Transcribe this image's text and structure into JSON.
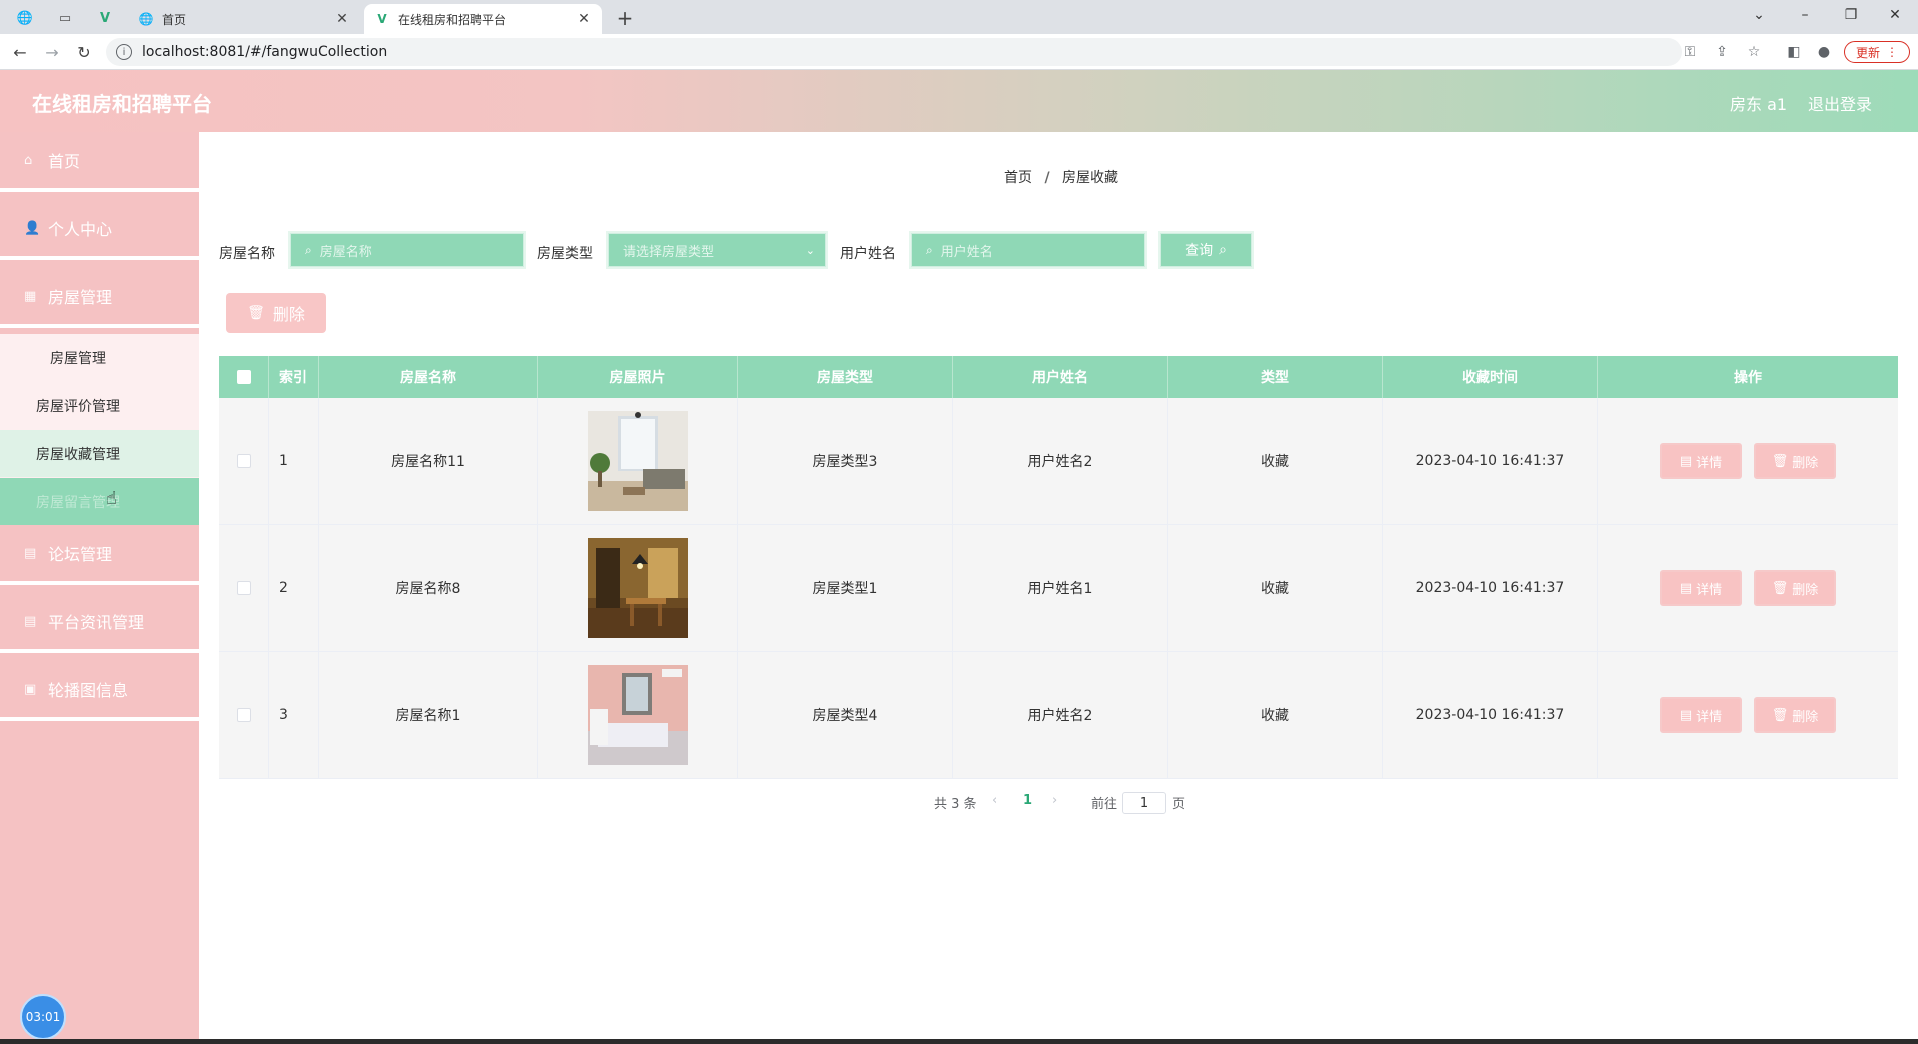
{
  "browser": {
    "tabs": [
      {
        "title": "首页",
        "close": "✕"
      },
      {
        "title": "在线租房和招聘平台",
        "close": "✕"
      }
    ],
    "new_tab": "+",
    "url": "localhost:8081/#/fangwuCollection",
    "update_label": "更新",
    "window_controls": {
      "chevron": "⌄",
      "minimize": "–",
      "restore": "❐",
      "close": "✕"
    }
  },
  "header": {
    "title": "在线租房和招聘平台",
    "user": "房东 a1",
    "logout": "退出登录"
  },
  "sidebar": {
    "items": [
      {
        "label": "首页",
        "icon": "home-icon"
      },
      {
        "label": "个人中心",
        "icon": "user-icon"
      },
      {
        "label": "房屋管理",
        "icon": "house-icon"
      },
      {
        "label": "论坛管理",
        "icon": "forum-icon"
      },
      {
        "label": "平台资讯管理",
        "icon": "news-icon"
      },
      {
        "label": "轮播图信息",
        "icon": "image-icon"
      }
    ],
    "submenu": [
      {
        "label": "房屋管理"
      },
      {
        "label": "房屋评价管理"
      },
      {
        "label": "房屋收藏管理"
      },
      {
        "label": "房屋留言管理"
      }
    ],
    "clock": "03:01"
  },
  "breadcrumb": {
    "home": "首页",
    "sep": "/",
    "current": "房屋收藏"
  },
  "filters": {
    "name_label": "房屋名称",
    "name_placeholder": "房屋名称",
    "type_label": "房屋类型",
    "type_placeholder": "请选择房屋类型",
    "user_label": "用户姓名",
    "user_placeholder": "用户姓名",
    "query_label": "查询"
  },
  "bulk_delete_label": "删除",
  "table": {
    "headers": [
      "索引",
      "房屋名称",
      "房屋照片",
      "房屋类型",
      "用户姓名",
      "类型",
      "收藏时间",
      "操作"
    ],
    "detail_label": "详情",
    "delete_label": "删除",
    "rows": [
      {
        "index": "1",
        "name": "房屋名称11",
        "type": "房屋类型3",
        "user": "用户姓名2",
        "kind": "收藏",
        "time": "2023-04-10 16:41:37"
      },
      {
        "index": "2",
        "name": "房屋名称8",
        "type": "房屋类型1",
        "user": "用户姓名1",
        "kind": "收藏",
        "time": "2023-04-10 16:41:37"
      },
      {
        "index": "3",
        "name": "房屋名称1",
        "type": "房屋类型4",
        "user": "用户姓名2",
        "kind": "收藏",
        "time": "2023-04-10 16:41:37"
      }
    ]
  },
  "pagination": {
    "total": "共 3 条",
    "current_page": "1",
    "goto_prefix": "前往",
    "goto_value": "1",
    "goto_suffix": "页"
  }
}
